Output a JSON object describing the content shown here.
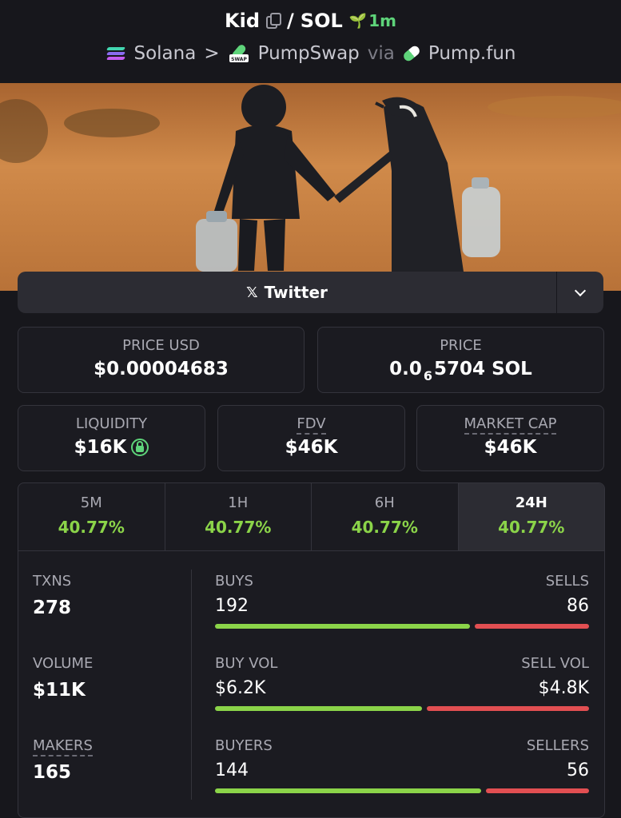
{
  "header": {
    "token": "Kid",
    "separator": "/",
    "quote": "SOL",
    "age": "1m",
    "chain": "Solana",
    "chevron": ">",
    "dex": "PumpSwap",
    "via": "via",
    "launchpad": "Pump.fun",
    "icons": [
      "copy-icon",
      "sprout-icon",
      "solana-icon",
      "pumpswap-icon",
      "pill-icon"
    ]
  },
  "twitter": {
    "x_glyph": "𝕏",
    "label": "Twitter"
  },
  "price_usd": {
    "label": "PRICE USD",
    "value": "$0.00004683"
  },
  "price": {
    "label": "PRICE",
    "prefix": "0.0",
    "zeros": "6",
    "suffix": "5704 SOL"
  },
  "liquidity": {
    "label": "LIQUIDITY",
    "value": "$16K"
  },
  "fdv": {
    "label": "FDV",
    "value": "$46K"
  },
  "market_cap": {
    "label": "MARKET CAP",
    "value": "$46K"
  },
  "tabs": [
    {
      "label": "5M",
      "value": "40.77%"
    },
    {
      "label": "1H",
      "value": "40.77%"
    },
    {
      "label": "6H",
      "value": "40.77%"
    },
    {
      "label": "24H",
      "value": "40.77%",
      "active": true
    }
  ],
  "txns": {
    "label": "TXNS",
    "value": "278"
  },
  "volume": {
    "label": "VOLUME",
    "value": "$11K"
  },
  "makers": {
    "label": "MAKERS",
    "value": "165"
  },
  "buys": {
    "label": "BUYS",
    "value": "192",
    "sell_label": "SELLS",
    "sell_value": "86",
    "buy_fraction": 0.69
  },
  "buy_vol": {
    "label": "BUY VOL",
    "value": "$6.2K",
    "sell_label": "SELL VOL",
    "sell_value": "$4.8K",
    "buy_fraction": 0.56
  },
  "buyers": {
    "label": "BUYERS",
    "value": "144",
    "sell_label": "SELLERS",
    "sell_value": "56",
    "buy_fraction": 0.72
  },
  "colors": {
    "green": "#8bd449",
    "red": "#e24f52",
    "bg": "#17171c",
    "panel": "#1b1b21"
  }
}
